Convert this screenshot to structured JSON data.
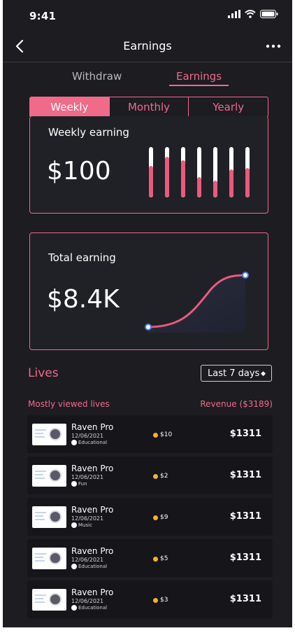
{
  "status": {
    "time": "9:41"
  },
  "header": {
    "title": "Earnings"
  },
  "top_tabs": [
    {
      "label": "Withdraw"
    },
    {
      "label": "Earnings"
    }
  ],
  "segments": [
    {
      "label": "Weekly"
    },
    {
      "label": "Monthly"
    },
    {
      "label": "Yearly"
    }
  ],
  "weekly_card": {
    "title": "Weekly earning",
    "value": "$100",
    "bar_fill_fractions": [
      0.62,
      0.8,
      0.74,
      0.4,
      0.33,
      0.55,
      0.58
    ]
  },
  "total_card": {
    "title": "Total earning",
    "value": "$8.4K"
  },
  "lives": {
    "title": "Lives",
    "filter": "Last 7 days",
    "left_header": "Mostly viewed lives",
    "right_header": "Revenue ($3189)",
    "rows": [
      {
        "name": "Raven Pro",
        "date": "12/06/2021",
        "category": "Educational",
        "coin": "$10",
        "revenue": "$1311"
      },
      {
        "name": "Raven Pro",
        "date": "12/06/2021",
        "category": "Fun",
        "coin": "$2",
        "revenue": "$1311"
      },
      {
        "name": "Raven Pro",
        "date": "12/06/2021",
        "category": "Music",
        "coin": "$9",
        "revenue": "$1311"
      },
      {
        "name": "Raven Pro",
        "date": "12/06/2021",
        "category": "Educational",
        "coin": "$5",
        "revenue": "$1311"
      },
      {
        "name": "Raven Pro",
        "date": "12/06/2021",
        "category": "Educational",
        "coin": "$3",
        "revenue": "$1311"
      }
    ]
  },
  "colors": {
    "accent": "#f06a8a",
    "background": "#1c1c21",
    "bar_fill": "#ea5a7e",
    "coin": "#f3b22a",
    "node": "#4a7cf0"
  }
}
